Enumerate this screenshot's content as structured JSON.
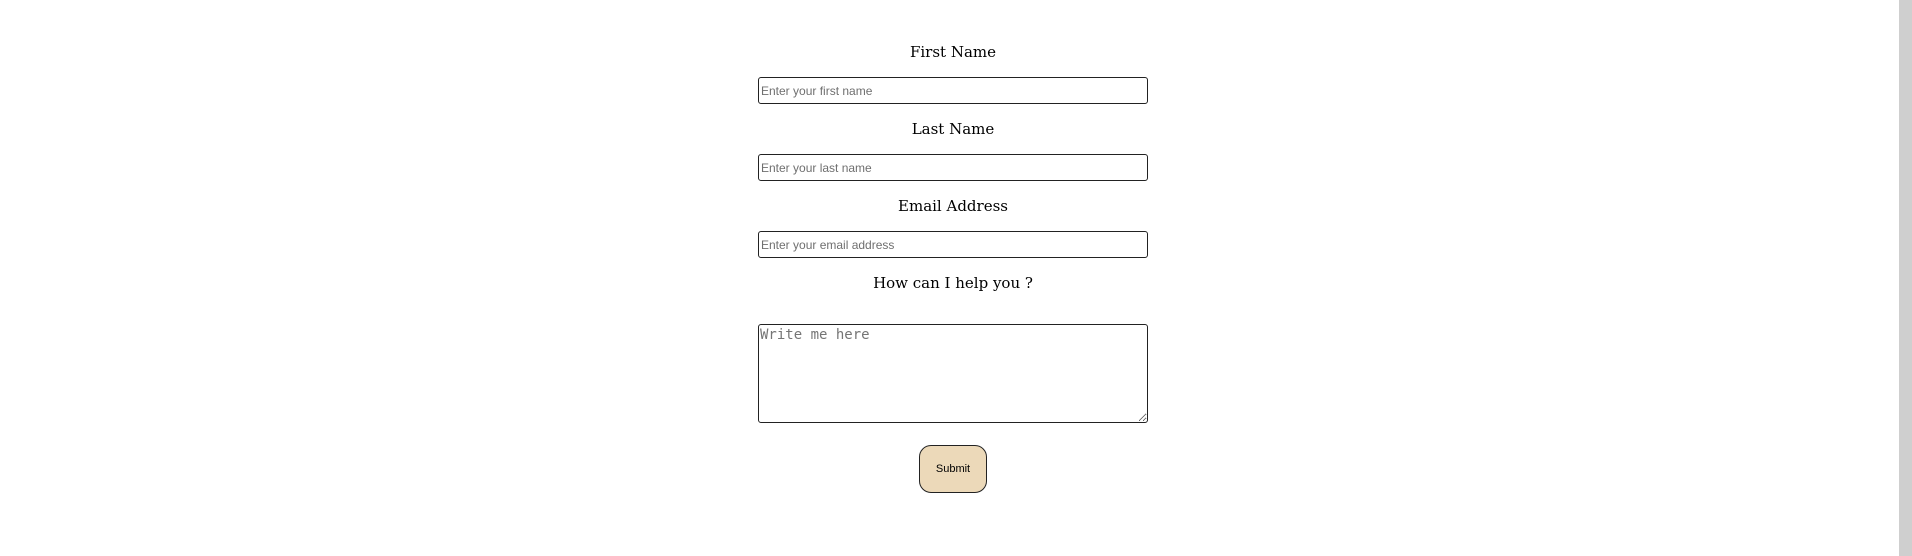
{
  "form": {
    "first_name": {
      "label": "First Name",
      "placeholder": "Enter your first name",
      "value": ""
    },
    "last_name": {
      "label": "Last Name",
      "placeholder": "Enter your last name",
      "value": ""
    },
    "email": {
      "label": "Email Address",
      "placeholder": "Enter your email address",
      "value": ""
    },
    "message": {
      "label": "How can I help you ?",
      "placeholder": "Write me here",
      "value": ""
    },
    "submit_label": "Submit",
    "submit_color": "#ecd9b9"
  }
}
